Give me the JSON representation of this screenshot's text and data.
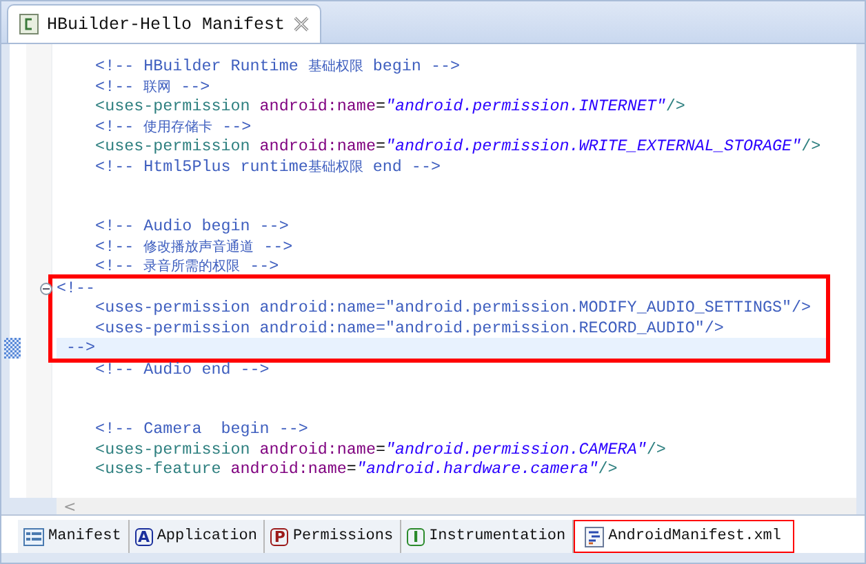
{
  "editor_tab": {
    "title": "HBuilder-Hello Manifest",
    "selected": true
  },
  "code_blocks": [
    {
      "highlighted": false,
      "lines": [
        {
          "kind": "code",
          "current": false,
          "foldable": false,
          "tokens": [
            {
              "kind": "comment",
              "s": "    <!-- HBuilder Runtime "
            },
            {
              "kind": "comment-cjk",
              "s": "基础权限"
            },
            {
              "kind": "comment",
              "s": " begin -->"
            }
          ]
        },
        {
          "kind": "code",
          "current": false,
          "foldable": false,
          "tokens": [
            {
              "kind": "comment",
              "s": "    <!-- "
            },
            {
              "kind": "comment-cjk",
              "s": "联网"
            },
            {
              "kind": "comment",
              "s": " -->"
            }
          ]
        },
        {
          "kind": "code",
          "current": false,
          "foldable": false,
          "tokens": [
            {
              "kind": "tag",
              "s": "    <uses-permission "
            },
            {
              "kind": "attr",
              "s": "android:name"
            },
            {
              "kind": "punct",
              "s": "="
            },
            {
              "kind": "string",
              "s": "\"android.permission.INTERNET\""
            },
            {
              "kind": "tag",
              "s": "/>"
            }
          ]
        },
        {
          "kind": "code",
          "current": false,
          "foldable": false,
          "tokens": [
            {
              "kind": "comment",
              "s": "    <!-- "
            },
            {
              "kind": "comment-cjk",
              "s": "使用存储卡"
            },
            {
              "kind": "comment",
              "s": " -->"
            }
          ]
        },
        {
          "kind": "code",
          "current": false,
          "foldable": false,
          "tokens": [
            {
              "kind": "tag",
              "s": "    <uses-permission "
            },
            {
              "kind": "attr",
              "s": "android:name"
            },
            {
              "kind": "punct",
              "s": "="
            },
            {
              "kind": "string",
              "s": "\"android.permission.WRITE_EXTERNAL_STORAGE\""
            },
            {
              "kind": "tag",
              "s": "/>"
            }
          ]
        },
        {
          "kind": "code",
          "current": false,
          "foldable": false,
          "tokens": [
            {
              "kind": "comment",
              "s": "    <!-- Html5Plus runtime"
            },
            {
              "kind": "comment-cjk",
              "s": "基础权限"
            },
            {
              "kind": "comment",
              "s": " end -->"
            }
          ]
        },
        {
          "kind": "blank"
        },
        {
          "kind": "blank"
        },
        {
          "kind": "code",
          "current": false,
          "foldable": false,
          "tokens": [
            {
              "kind": "comment",
              "s": "    <!-- Audio begin -->"
            }
          ]
        },
        {
          "kind": "code",
          "current": false,
          "foldable": false,
          "tokens": [
            {
              "kind": "comment",
              "s": "    <!-- "
            },
            {
              "kind": "comment-cjk",
              "s": "修改播放声音通道"
            },
            {
              "kind": "comment",
              "s": " -->"
            }
          ]
        },
        {
          "kind": "code",
          "current": false,
          "foldable": false,
          "tokens": [
            {
              "kind": "comment",
              "s": "    <!-- "
            },
            {
              "kind": "comment-cjk",
              "s": "录音所需的权限"
            },
            {
              "kind": "comment",
              "s": " -->"
            }
          ]
        }
      ]
    },
    {
      "highlighted": true,
      "lines": [
        {
          "kind": "code",
          "current": false,
          "foldable": true,
          "tokens": [
            {
              "kind": "comment",
              "s": "<!--"
            }
          ]
        },
        {
          "kind": "code",
          "current": false,
          "foldable": false,
          "tokens": [
            {
              "kind": "comment",
              "s": "    <uses-permission android:name=\"android.permission.MODIFY_AUDIO_SETTINGS\"/>"
            }
          ]
        },
        {
          "kind": "code",
          "current": false,
          "foldable": false,
          "tokens": [
            {
              "kind": "comment",
              "s": "    <uses-permission android:name=\"android.permission.RECORD_AUDIO\"/>"
            }
          ]
        },
        {
          "kind": "code",
          "current": true,
          "foldable": false,
          "tokens": [
            {
              "kind": "comment",
              "s": " -->"
            }
          ]
        }
      ]
    },
    {
      "highlighted": false,
      "lines": [
        {
          "kind": "code",
          "current": false,
          "foldable": false,
          "tokens": [
            {
              "kind": "comment",
              "s": "    <!-- Audio end -->"
            }
          ]
        },
        {
          "kind": "blank"
        },
        {
          "kind": "blank"
        },
        {
          "kind": "code",
          "current": false,
          "foldable": false,
          "tokens": [
            {
              "kind": "comment",
              "s": "    <!-- Camera  begin -->"
            }
          ]
        },
        {
          "kind": "code",
          "current": false,
          "foldable": false,
          "tokens": [
            {
              "kind": "tag",
              "s": "    <uses-permission "
            },
            {
              "kind": "attr",
              "s": "android:name"
            },
            {
              "kind": "punct",
              "s": "="
            },
            {
              "kind": "string",
              "s": "\"android.permission.CAMERA\""
            },
            {
              "kind": "tag",
              "s": "/>"
            }
          ]
        },
        {
          "kind": "code",
          "current": false,
          "foldable": false,
          "tokens": [
            {
              "kind": "tag",
              "s": "    <uses-feature "
            },
            {
              "kind": "attr",
              "s": "android:name"
            },
            {
              "kind": "punct",
              "s": "="
            },
            {
              "kind": "string",
              "s": "\"android.hardware.camera\""
            },
            {
              "kind": "tag",
              "s": "/>"
            }
          ]
        }
      ]
    }
  ],
  "scroll_left_arrow": "<",
  "bottom_tabs": [
    {
      "kind": "manifest",
      "label": "Manifest",
      "selected": false,
      "highlighted": false
    },
    {
      "kind": "letter",
      "icon_letter": "A",
      "color": "#1a2f9c",
      "label": "Application",
      "selected": false,
      "highlighted": false
    },
    {
      "kind": "letter",
      "icon_letter": "P",
      "color": "#9c1a1a",
      "label": "Permissions",
      "selected": false,
      "highlighted": false
    },
    {
      "kind": "letter",
      "icon_letter": "I",
      "color": "#2b8a2b",
      "label": "Instrumentation",
      "selected": false,
      "highlighted": false
    },
    {
      "kind": "xml",
      "label": "AndroidManifest.xml",
      "selected": true,
      "highlighted": true
    }
  ]
}
